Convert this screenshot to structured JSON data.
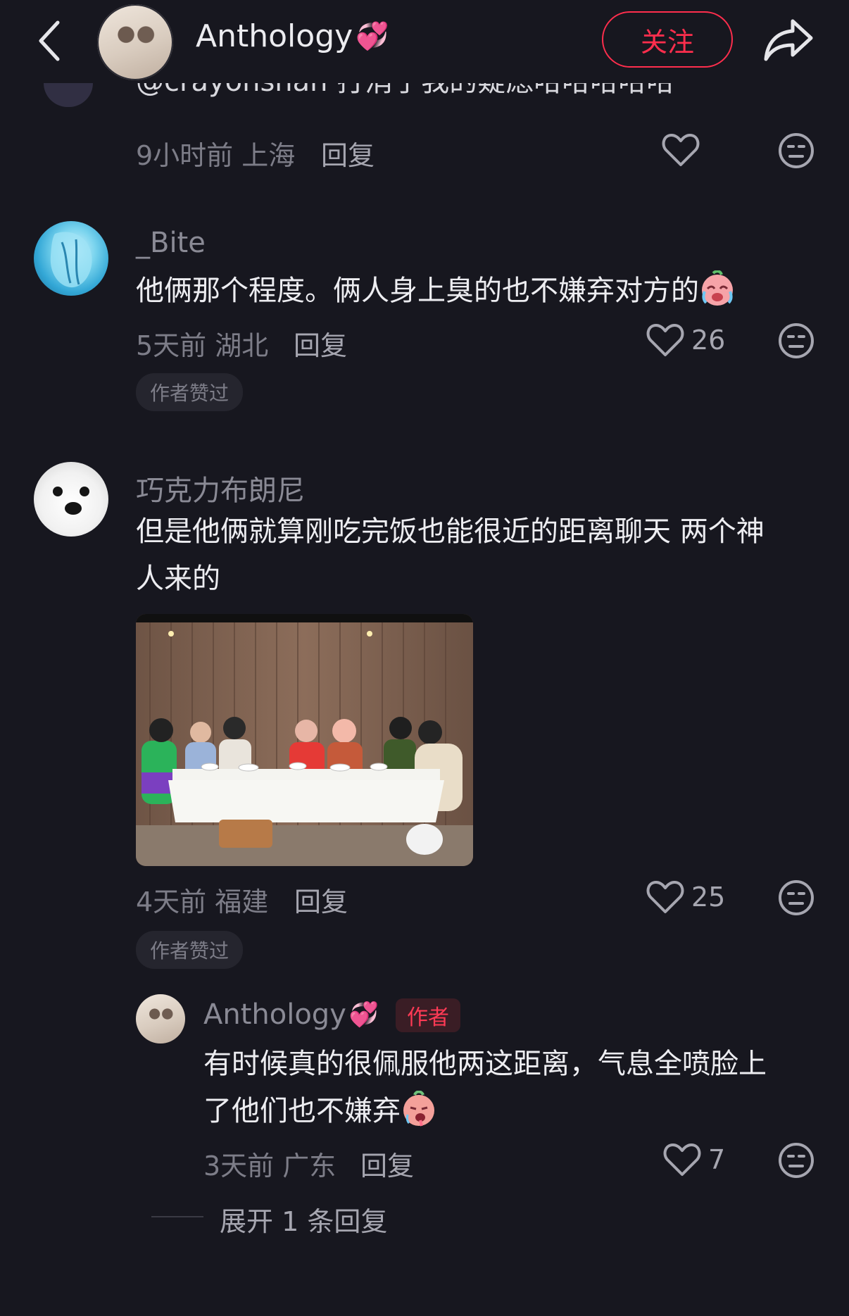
{
  "header": {
    "back_icon": "chevron-left-icon",
    "author_name": "Anthology",
    "author_emoji": "💞",
    "follow_label": "关注",
    "share_icon": "share-icon",
    "accent": "#ff2e4d"
  },
  "cut_comment": {
    "text": "@crayonshan 打消了我的疑虑哈哈哈哈哈",
    "time": "9小时前",
    "location": "上海",
    "reply_label": "回复"
  },
  "comments": [
    {
      "username": "_Bite",
      "text": "他俩那个程度。俩人身上臭的也不嫌弃对方的",
      "emoji": "😂",
      "time": "5天前",
      "location": "湖北",
      "reply_label": "回复",
      "likes": "26",
      "badge": "作者赞过"
    },
    {
      "username": "巧克力布朗尼",
      "text_line1": "但是他俩就算刚吃完饭也能很近的距离聊天 两个神",
      "text_line2": "人来的",
      "time": "4天前",
      "location": "福建",
      "reply_label": "回复",
      "likes": "25",
      "badge": "作者赞过"
    }
  ],
  "author_reply": {
    "username": "Anthology",
    "emoji": "💞",
    "author_tag": "作者",
    "text_line1": "有时候真的很佩服他两这距离，气息全喷脸上",
    "text_line2": "了他们也不嫌弃",
    "text_emoji": "🥵",
    "time": "3天前",
    "location": "广东",
    "reply_label": "回复",
    "likes": "7"
  },
  "expand_label": "展开 1 条回复"
}
